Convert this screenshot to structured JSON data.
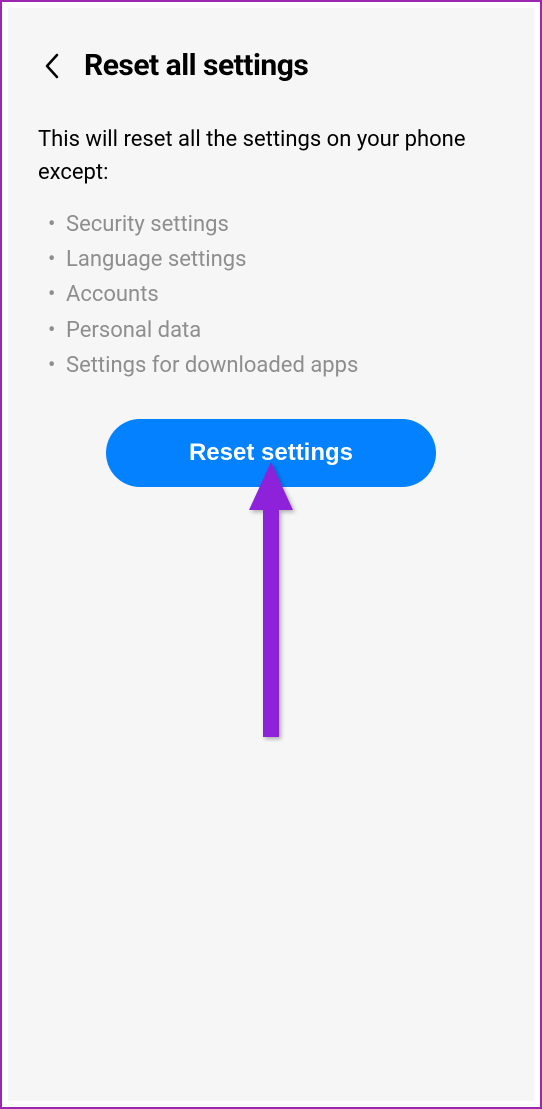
{
  "header": {
    "title": "Reset all settings"
  },
  "description": "This will reset all the settings on your phone except:",
  "exceptions": {
    "item0": "Security settings",
    "item1": "Language settings",
    "item2": "Accounts",
    "item3": "Personal data",
    "item4": "Settings for downloaded apps"
  },
  "button": {
    "label": "Reset settings"
  }
}
